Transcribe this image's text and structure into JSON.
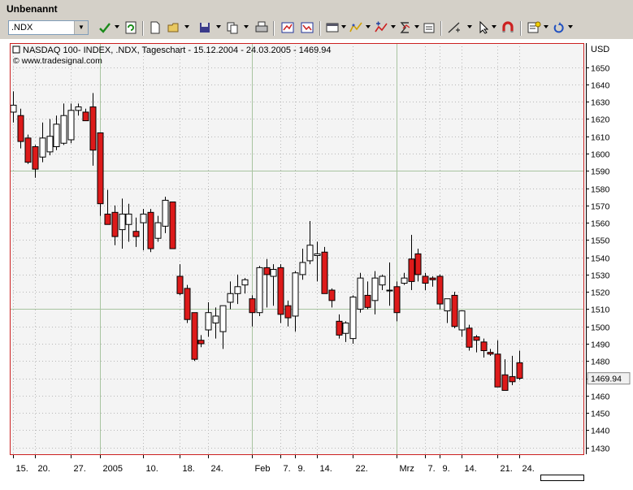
{
  "window": {
    "title": "Unbenannt"
  },
  "toolbar": {
    "symbol_value": ".NDX",
    "buttons": [
      "check-icon",
      "refresh-icon",
      "new-document-icon",
      "open-folder-icon",
      "save-icon",
      "copy-icon",
      "print-icon",
      "chart-back-icon",
      "chart-forward-icon",
      "chart-window-icon",
      "indicator-icon",
      "indicator-add-icon",
      "sigma-indicator-icon",
      "properties-icon",
      "line-tool-icon",
      "cursor-icon",
      "magnet-icon",
      "notes-icon",
      "undo-icon"
    ]
  },
  "chart_data": {
    "type": "candlestick",
    "title": "NASDAQ 100- INDEX, .NDX, Tageschart - 15.12.2004 - 24.03.2005 - 1469.94",
    "source": "© www.tradesignal.com",
    "currency_label": "USD",
    "last_price_label": "1469.94",
    "ylim": [
      1427,
      1663
    ],
    "y_ticks": [
      1430,
      1440,
      1450,
      1460,
      1470,
      1480,
      1490,
      1500,
      1510,
      1520,
      1530,
      1540,
      1550,
      1560,
      1570,
      1580,
      1590,
      1600,
      1610,
      1620,
      1630,
      1640,
      1650
    ],
    "x_tick_labels": [
      {
        "label": "15.",
        "index": 0
      },
      {
        "label": "20.",
        "index": 3
      },
      {
        "label": "27.",
        "index": 8
      },
      {
        "label": "2005",
        "index": 12
      },
      {
        "label": "10.",
        "index": 18
      },
      {
        "label": "18.",
        "index": 23
      },
      {
        "label": "24.",
        "index": 27
      },
      {
        "label": "Feb",
        "index": 33
      },
      {
        "label": "7.",
        "index": 37
      },
      {
        "label": "9.",
        "index": 39
      },
      {
        "label": "14.",
        "index": 42
      },
      {
        "label": "22.",
        "index": 47
      },
      {
        "label": "Mrz",
        "index": 53
      },
      {
        "label": "7.",
        "index": 57
      },
      {
        "label": "9.",
        "index": 59
      },
      {
        "label": "14.",
        "index": 62
      },
      {
        "label": "21.",
        "index": 67
      },
      {
        "label": "24.",
        "index": 70
      }
    ],
    "grid_major_y": [
      1510,
      1590
    ],
    "grid_major_x_index": [
      12,
      33,
      53
    ],
    "candles": [
      {
        "o": 1624,
        "h": 1636,
        "l": 1618,
        "c": 1628
      },
      {
        "o": 1622,
        "h": 1626,
        "l": 1603,
        "c": 1607
      },
      {
        "o": 1609,
        "h": 1611,
        "l": 1594,
        "c": 1595
      },
      {
        "o": 1604,
        "h": 1605,
        "l": 1586,
        "c": 1591
      },
      {
        "o": 1598,
        "h": 1618,
        "l": 1595,
        "c": 1609
      },
      {
        "o": 1601,
        "h": 1620,
        "l": 1599,
        "c": 1610
      },
      {
        "o": 1604,
        "h": 1622,
        "l": 1602,
        "c": 1617
      },
      {
        "o": 1606,
        "h": 1629,
        "l": 1605,
        "c": 1622
      },
      {
        "o": 1608,
        "h": 1629,
        "l": 1606,
        "c": 1625
      },
      {
        "o": 1625,
        "h": 1629,
        "l": 1622,
        "c": 1627
      },
      {
        "o": 1624,
        "h": 1626,
        "l": 1621,
        "c": 1619
      },
      {
        "o": 1627,
        "h": 1635,
        "l": 1593,
        "c": 1602
      },
      {
        "o": 1612,
        "h": 1612,
        "l": 1564,
        "c": 1571
      },
      {
        "o": 1565,
        "h": 1579,
        "l": 1562,
        "c": 1559
      },
      {
        "o": 1566,
        "h": 1570,
        "l": 1547,
        "c": 1552
      },
      {
        "o": 1556,
        "h": 1574,
        "l": 1545,
        "c": 1565
      },
      {
        "o": 1559,
        "h": 1571,
        "l": 1549,
        "c": 1565
      },
      {
        "o": 1555,
        "h": 1563,
        "l": 1546,
        "c": 1552
      },
      {
        "o": 1560,
        "h": 1568,
        "l": 1544,
        "c": 1565
      },
      {
        "o": 1566,
        "h": 1568,
        "l": 1543,
        "c": 1545
      },
      {
        "o": 1551,
        "h": 1564,
        "l": 1549,
        "c": 1560
      },
      {
        "o": 1558,
        "h": 1575,
        "l": 1554,
        "c": 1573
      },
      {
        "o": 1572,
        "h": 1572,
        "l": 1545,
        "c": 1545
      },
      {
        "o": 1529,
        "h": 1536,
        "l": 1518,
        "c": 1519
      },
      {
        "o": 1522,
        "h": 1524,
        "l": 1502,
        "c": 1504
      },
      {
        "o": 1508,
        "h": 1508,
        "l": 1480,
        "c": 1481
      },
      {
        "o": 1492,
        "h": 1495,
        "l": 1488,
        "c": 1490
      },
      {
        "o": 1498,
        "h": 1514,
        "l": 1494,
        "c": 1508
      },
      {
        "o": 1502,
        "h": 1511,
        "l": 1493,
        "c": 1506
      },
      {
        "o": 1497,
        "h": 1510,
        "l": 1487,
        "c": 1512
      },
      {
        "o": 1514,
        "h": 1526,
        "l": 1510,
        "c": 1519
      },
      {
        "o": 1519,
        "h": 1530,
        "l": 1513,
        "c": 1523
      },
      {
        "o": 1524,
        "h": 1528,
        "l": 1519,
        "c": 1527
      },
      {
        "o": 1516,
        "h": 1518,
        "l": 1500,
        "c": 1508
      },
      {
        "o": 1508,
        "h": 1535,
        "l": 1506,
        "c": 1534
      },
      {
        "o": 1534,
        "h": 1539,
        "l": 1511,
        "c": 1530
      },
      {
        "o": 1529,
        "h": 1536,
        "l": 1512,
        "c": 1533
      },
      {
        "o": 1534,
        "h": 1536,
        "l": 1502,
        "c": 1507
      },
      {
        "o": 1512,
        "h": 1515,
        "l": 1500,
        "c": 1505
      },
      {
        "o": 1506,
        "h": 1532,
        "l": 1497,
        "c": 1531
      },
      {
        "o": 1530,
        "h": 1545,
        "l": 1527,
        "c": 1537
      },
      {
        "o": 1538,
        "h": 1561,
        "l": 1536,
        "c": 1547
      },
      {
        "o": 1541,
        "h": 1549,
        "l": 1526,
        "c": 1542
      },
      {
        "o": 1543,
        "h": 1546,
        "l": 1520,
        "c": 1519
      },
      {
        "o": 1521,
        "h": 1522,
        "l": 1511,
        "c": 1515
      },
      {
        "o": 1503,
        "h": 1507,
        "l": 1493,
        "c": 1495
      },
      {
        "o": 1496,
        "h": 1503,
        "l": 1491,
        "c": 1502
      },
      {
        "o": 1493,
        "h": 1518,
        "l": 1490,
        "c": 1517
      },
      {
        "o": 1510,
        "h": 1531,
        "l": 1508,
        "c": 1528
      },
      {
        "o": 1518,
        "h": 1526,
        "l": 1510,
        "c": 1511
      },
      {
        "o": 1515,
        "h": 1532,
        "l": 1507,
        "c": 1528
      },
      {
        "o": 1524,
        "h": 1530,
        "l": 1521,
        "c": 1529
      },
      {
        "o": 1521,
        "h": 1537,
        "l": 1512,
        "c": 1521
      },
      {
        "o": 1523,
        "h": 1526,
        "l": 1503,
        "c": 1508
      },
      {
        "o": 1525,
        "h": 1531,
        "l": 1524,
        "c": 1528
      },
      {
        "o": 1539,
        "h": 1553,
        "l": 1521,
        "c": 1526
      },
      {
        "o": 1542,
        "h": 1545,
        "l": 1526,
        "c": 1530
      },
      {
        "o": 1529,
        "h": 1531,
        "l": 1521,
        "c": 1525
      },
      {
        "o": 1528,
        "h": 1529,
        "l": 1523,
        "c": 1527
      },
      {
        "o": 1529,
        "h": 1530,
        "l": 1510,
        "c": 1513
      },
      {
        "o": 1509,
        "h": 1514,
        "l": 1502,
        "c": 1516
      },
      {
        "o": 1518,
        "h": 1520,
        "l": 1499,
        "c": 1500
      },
      {
        "o": 1498,
        "h": 1508,
        "l": 1494,
        "c": 1509
      },
      {
        "o": 1499,
        "h": 1501,
        "l": 1486,
        "c": 1488
      },
      {
        "o": 1494,
        "h": 1495,
        "l": 1485,
        "c": 1492
      },
      {
        "o": 1491,
        "h": 1493,
        "l": 1482,
        "c": 1486
      },
      {
        "o": 1485,
        "h": 1487,
        "l": 1483,
        "c": 1484
      },
      {
        "o": 1484,
        "h": 1492,
        "l": 1468,
        "c": 1465
      },
      {
        "o": 1472,
        "h": 1481,
        "l": 1463,
        "c": 1463
      },
      {
        "o": 1471,
        "h": 1483,
        "l": 1466,
        "c": 1468
      },
      {
        "o": 1479,
        "h": 1486,
        "l": 1469,
        "c": 1470
      }
    ],
    "colors": {
      "up_fill": "#ffffff",
      "down_fill": "#dd1a1a",
      "wick": "#000000",
      "frame": "#cc2020",
      "grid_major": "#a8c4a0",
      "grid_minor": "#b8b8b8",
      "plot_background": "#f4f4f4"
    }
  }
}
